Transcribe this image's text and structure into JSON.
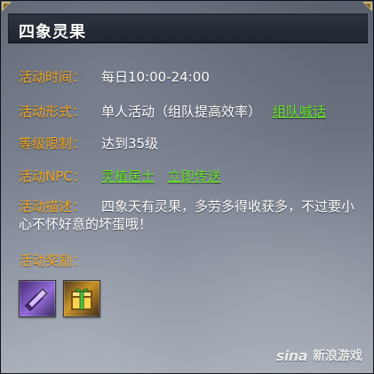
{
  "dialog": {
    "title": "四象灵果"
  },
  "rows": [
    {
      "label": "活动时间：",
      "value": "每日10:00-24:00"
    },
    {
      "label": "活动形式：",
      "value": "单人活动（组队提高效率）",
      "link": "组队喊话"
    },
    {
      "label": "等级限制：",
      "value": "达到35级"
    },
    {
      "label": "活动NPC：",
      "npc": "灵植居士",
      "teleport": "立即传送"
    }
  ],
  "description": {
    "label": "活动描述：",
    "text": "四象天有灵果，多劳多得收获多，不过要小心不怀好意的坏蛋哦！"
  },
  "rewards": {
    "label": "活动奖励：",
    "items": [
      {
        "icon": "purple-scroll-icon"
      },
      {
        "icon": "green-giftbox-icon"
      }
    ]
  },
  "watermark": {
    "logo": "sina",
    "text": "新浪游戏"
  },
  "colors": {
    "label": "#f2a51d",
    "value": "#ffffff",
    "link": "#68e52a",
    "title_bg": "#1f2630"
  }
}
